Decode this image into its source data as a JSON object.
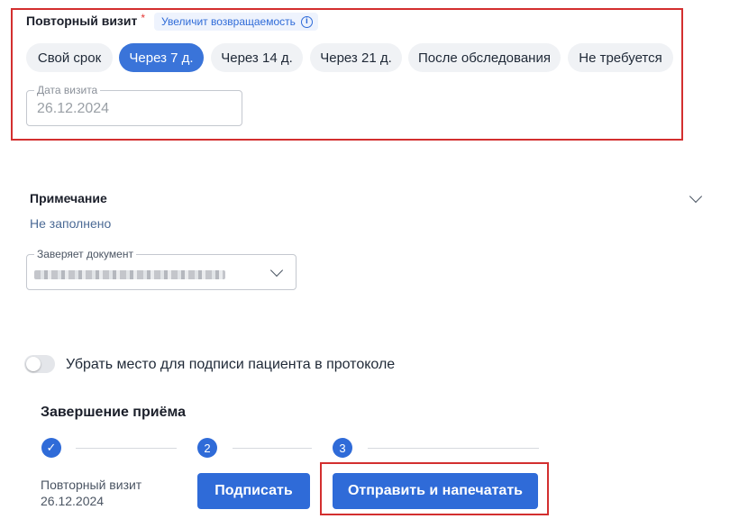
{
  "return_visit": {
    "title": "Повторный визит",
    "required_mark": "*",
    "badge": "Увеличит возвращаемость",
    "badge_icon": "info-icon",
    "options": [
      "Свой срок",
      "Через 7 д.",
      "Через 14 д.",
      "Через 21 д.",
      "После обследования",
      "Не требуется"
    ],
    "selected": "Через 7 д.",
    "date_field": {
      "label": "Дата визита",
      "value": "26.12.2024"
    }
  },
  "note": {
    "title": "Примечание",
    "value": "Не заполнено",
    "expand_icon": "chevron-down-icon"
  },
  "certifier": {
    "label": "Заверяет документ",
    "value_redacted": true
  },
  "signature_toggle": {
    "label": "Убрать место для подписи пациента в протоколе",
    "checked": false
  },
  "finish": {
    "title": "Завершение приёма",
    "steps": [
      {
        "marker": "✓",
        "status": "done",
        "text_line1": "Повторный визит",
        "text_line2": "26.12.2024"
      },
      {
        "marker": "2",
        "status": "current",
        "button": "Подписать"
      },
      {
        "marker": "3",
        "status": "pending",
        "button": "Отправить и напечатать"
      }
    ]
  },
  "colors": {
    "accent": "#2f6bd8",
    "chip_active": "#3a74d9",
    "highlight": "#d32f2f",
    "required": "#e53935"
  }
}
